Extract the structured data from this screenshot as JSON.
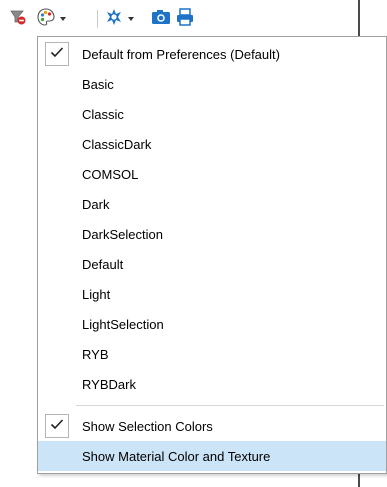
{
  "toolbar": {
    "icons": [
      {
        "name": "clear-selection-icon"
      },
      {
        "name": "color-theme-icon",
        "has_dropdown": true
      },
      {
        "name": "scene-light-icon",
        "has_dropdown": true
      },
      {
        "name": "camera-icon"
      },
      {
        "name": "print-icon"
      }
    ],
    "colors": {
      "accent_blue": "#1e73c8",
      "eraser_red": "#d42a2a"
    }
  },
  "menu": {
    "items": [
      {
        "label": "Default from Preferences (Default)",
        "checked": true
      },
      {
        "label": "Basic",
        "checked": false
      },
      {
        "label": "Classic",
        "checked": false
      },
      {
        "label": "ClassicDark",
        "checked": false
      },
      {
        "label": "COMSOL",
        "checked": false
      },
      {
        "label": "Dark",
        "checked": false
      },
      {
        "label": "DarkSelection",
        "checked": false
      },
      {
        "label": "Default",
        "checked": false
      },
      {
        "label": "Light",
        "checked": false
      },
      {
        "label": "LightSelection",
        "checked": false
      },
      {
        "label": "RYB",
        "checked": false
      },
      {
        "label": "RYBDark",
        "checked": false
      }
    ],
    "options": [
      {
        "label": "Show Selection Colors",
        "checked": true
      },
      {
        "label": "Show Material Color and Texture",
        "checked": false,
        "highlighted": true
      }
    ],
    "highlight_color": "#cce4f7"
  }
}
